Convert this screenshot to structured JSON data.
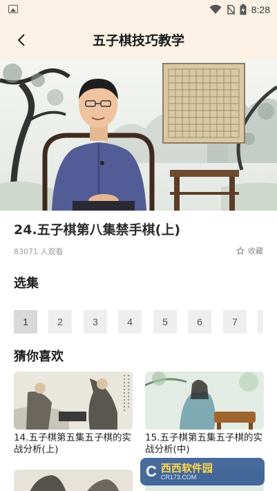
{
  "status_bar": {
    "time": "8:28"
  },
  "header": {
    "title": "五子棋技巧教学"
  },
  "video": {
    "state": "playing"
  },
  "episode": {
    "title": "24.五子棋第八集禁手棋(上)",
    "view_count": "83071 人观看",
    "favorite_label": "收藏"
  },
  "episodes_section": {
    "title": "选集",
    "items": [
      "1",
      "2",
      "3",
      "4",
      "5",
      "6",
      "7"
    ],
    "selected": "1"
  },
  "recommend_section": {
    "title": "猜你喜欢",
    "items": [
      {
        "caption": "14.五子棋第五集五子棋的实战分析(上)"
      },
      {
        "caption": "15.五子棋第五集五子棋的实战分析(中)"
      }
    ]
  },
  "watermark": {
    "logo": "C",
    "name": "西西软件园",
    "url": "CR173.COM"
  },
  "colors": {
    "header_bg": "#fbf1e4",
    "episode_bg": "#eeeeee",
    "episode_active_bg": "#d9d9d9"
  }
}
